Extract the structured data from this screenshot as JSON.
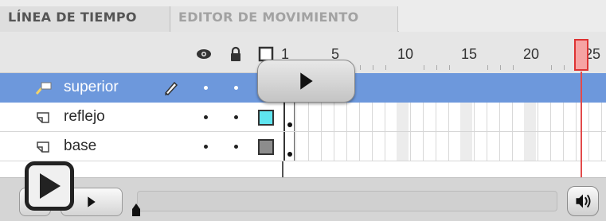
{
  "tabs": [
    {
      "label": "LÍNEA DE TIEMPO",
      "active": true
    },
    {
      "label": "EDITOR DE MOVIMIENTO",
      "active": false
    }
  ],
  "header_icons": [
    "eye-icon",
    "lock-icon",
    "outline-icon"
  ],
  "ruler": {
    "labels": [
      "1",
      "5",
      "10",
      "15",
      "20",
      "25"
    ]
  },
  "layers": [
    {
      "name": "superior",
      "icon": "layer-guide-icon",
      "selected": true,
      "editable": true,
      "swatch_color": "#ffffff"
    },
    {
      "name": "reflejo",
      "icon": "layer-masked-icon",
      "selected": false,
      "editable": false,
      "swatch_color": "#5fe4ef"
    },
    {
      "name": "base",
      "icon": "layer-masked-icon",
      "selected": false,
      "editable": false,
      "swatch_color": "#8c8c8c"
    }
  ],
  "playhead": {
    "frame": 25
  },
  "colors": {
    "selection": "#6d98dc",
    "playhead": "#e34a4a"
  },
  "controls": {
    "play_icon": "play-icon",
    "sound_icon": "speaker-icon"
  }
}
